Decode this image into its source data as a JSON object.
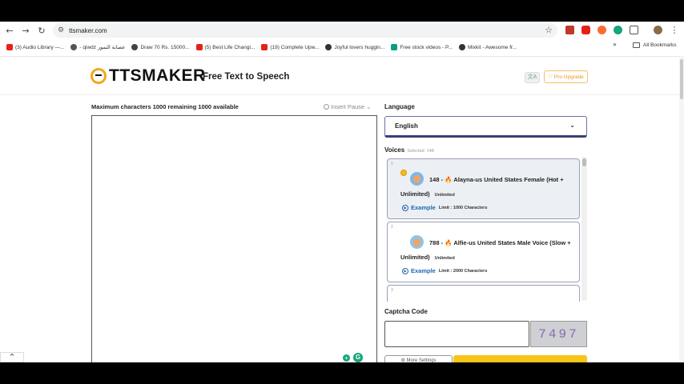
{
  "browser": {
    "url": "ttsmaker.com",
    "bookmarks": [
      {
        "label": "(3) Audio Library —...",
        "color": "#e62117"
      },
      {
        "label": "- qiwdz عصابة النمور",
        "color": "#555555"
      },
      {
        "label": "Draw 70 Rs. 15000...",
        "color": "#444444"
      },
      {
        "label": "(5) Best Life Changi...",
        "color": "#e62117"
      },
      {
        "label": "(19) Complete Upw...",
        "color": "#e62117"
      },
      {
        "label": "Joyful lovers huggin...",
        "color": "#333333"
      },
      {
        "label": "Free stock videos - P...",
        "color": "#05a081"
      },
      {
        "label": "Mixkit - Awesome fr...",
        "color": "#333333"
      }
    ],
    "more": "»",
    "all_bookmarks": "All Bookmarks"
  },
  "header": {
    "logo_text": "TTSMAKER",
    "tagline": "Free Text to Speech",
    "lang_toggle": "文A",
    "upgrade_label": "♡ Pro Upgrade"
  },
  "editor": {
    "max_chars_text": "Maximum characters 1000 remaining 1000 available",
    "insert_pause": "Insert Pause ⌄",
    "grammarly": "G",
    "gplus": "+"
  },
  "language": {
    "label": "Language",
    "selected": "English"
  },
  "voices": {
    "label": "Voices",
    "selected_text": "Selected: 148",
    "items": [
      {
        "num": "1",
        "title": "148 - 🔥 Alayna-us United States Female (Hot +",
        "title2": "Unlimited)",
        "badge": "Unlimited",
        "example": "Example",
        "limit": "Limit : 1000 Characters"
      },
      {
        "num": "2",
        "title": "788 - 🔥 Alfie-us United States Male Voice (Slow +",
        "title2": "Unlimited)",
        "badge": "Unlimited",
        "example": "Example",
        "limit": "Limit : 2000 Characters"
      },
      {
        "num": "3",
        "title": "",
        "title2": "",
        "badge": "",
        "example": "",
        "limit": ""
      }
    ]
  },
  "captcha": {
    "label": "Captcha Code",
    "code": "7497"
  },
  "actions": {
    "more_settings": "⚙ More Settings",
    "convert": ""
  }
}
